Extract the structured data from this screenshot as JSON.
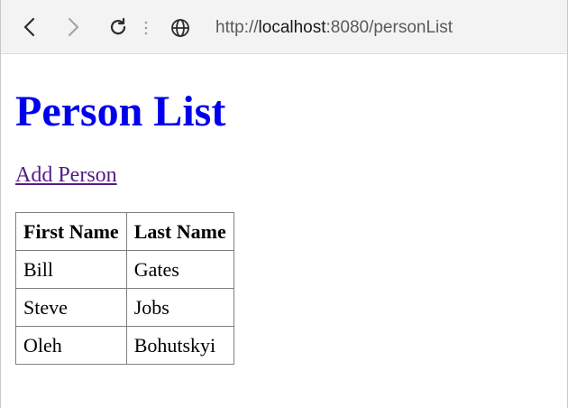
{
  "browser": {
    "url_prefix": "http://",
    "url_host": "localhost",
    "url_rest": ":8080/personList",
    "icons": {
      "back": "chevron-left-icon",
      "forward": "chevron-right-icon",
      "reload": "reload-icon",
      "site": "globe-icon"
    }
  },
  "page": {
    "title": "Person List",
    "add_link": "Add Person",
    "title_color": "#0000ee",
    "link_color": "#551a8b"
  },
  "table": {
    "headers": [
      "First Name",
      "Last Name"
    ],
    "rows": [
      [
        "Bill",
        "Gates"
      ],
      [
        "Steve",
        "Jobs"
      ],
      [
        "Oleh",
        "Bohutskyi"
      ]
    ]
  }
}
